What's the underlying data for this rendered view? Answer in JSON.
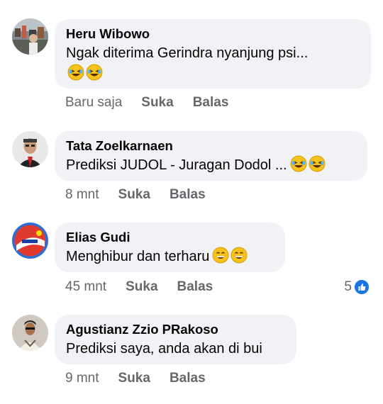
{
  "comments": [
    {
      "author": "Heru Wibowo",
      "text": "Ngak diterima Gerindra nyanjung psi...",
      "emoji": [
        "laughing-crying-emoji",
        "laughing-crying-emoji"
      ],
      "time": "Baru saja",
      "like_label": "Suka",
      "reply_label": "Balas"
    },
    {
      "author": "Tata Zoelkarnaen",
      "text": "Prediksi JUDOL - Juragan Dodol ...",
      "emoji": [
        "laughing-crying-emoji",
        "laughing-crying-emoji"
      ],
      "time": "8 mnt",
      "like_label": "Suka",
      "reply_label": "Balas"
    },
    {
      "author": "Elias Gudi",
      "text": "Menghibur dan terharu",
      "emoji": [
        "grinning-emoji",
        "grinning-emoji"
      ],
      "time": "45 mnt",
      "like_label": "Suka",
      "reply_label": "Balas",
      "reaction_count": "5",
      "reaction_icon": "like-icon"
    },
    {
      "author": "Agustianz Zzio PRakoso",
      "text": "Prediksi saya, anda akan di bui",
      "time": "9 mnt",
      "like_label": "Suka",
      "reply_label": "Balas"
    }
  ],
  "colors": {
    "bubble": "#f0f2f5",
    "meta_text": "#65676b",
    "like_blue": "#1b74e4"
  }
}
